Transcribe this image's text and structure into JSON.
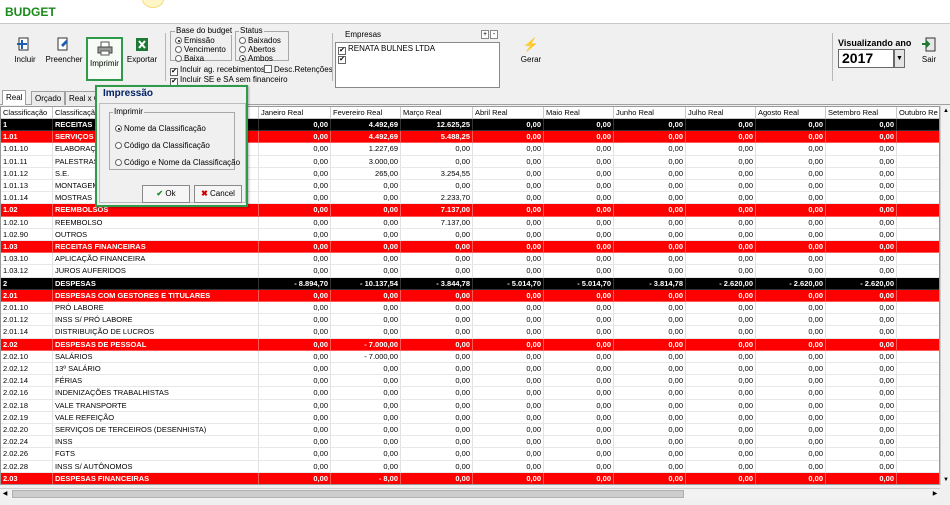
{
  "window": {
    "title": "BUDGET"
  },
  "toolbar": {
    "buttons": [
      {
        "label": "Incluir",
        "icon": "add-doc-icon"
      },
      {
        "label": "Preencher",
        "icon": "fill-icon"
      },
      {
        "label": "Imprimir",
        "icon": "printer-icon"
      },
      {
        "label": "Exportar",
        "icon": "excel-icon"
      },
      {
        "label": "Gerar",
        "icon": "lightning-icon"
      },
      {
        "label": "Sair",
        "icon": "exit-icon"
      }
    ],
    "base": {
      "title": "Base do budget",
      "options": [
        "Emissão",
        "Vencimento",
        "Baixa"
      ],
      "selected": "Emissão"
    },
    "status": {
      "title": "Status",
      "options": [
        "Baixados",
        "Abertos",
        "Ambos"
      ],
      "selected": "Ambos"
    },
    "checks": {
      "incluir_ag": "Incluir ag. recebimentos",
      "desc_ret": "Desc.Retenções",
      "incluir_se": "Incluir SE e SA sem financeiro"
    },
    "empresas": {
      "title": "Empresas",
      "plus": "+",
      "minus": "-",
      "items": [
        "RENATA BULNES LTDA",
        ""
      ]
    },
    "visualizando": {
      "label": "Visualizando ano",
      "year": "2017"
    }
  },
  "tabs": [
    "Real",
    "Orçado",
    "Real x O"
  ],
  "grid": {
    "headers": [
      "Classificação",
      "Classificação",
      "Janeiro Real",
      "Fevereiro Real",
      "Março Real",
      "Abril Real",
      "Maio Real",
      "Junho Real",
      "Julho Real",
      "Agosto Real",
      "Setembro Real",
      "Outubro Re"
    ],
    "rows": [
      {
        "code": "1",
        "name": "RECEITAS",
        "style": "black",
        "v": [
          "0,00",
          "4.492,69",
          "12.625,25",
          "0,00",
          "0,00",
          "0,00",
          "0,00",
          "0,00",
          "0,00"
        ]
      },
      {
        "code": "1.01",
        "name": "SERVIÇOS",
        "style": "red",
        "v": [
          "0,00",
          "4.492,69",
          "5.488,25",
          "0,00",
          "0,00",
          "0,00",
          "0,00",
          "0,00",
          "0,00"
        ]
      },
      {
        "code": "1.01.10",
        "name": "ELABORAÇÃO",
        "style": "",
        "v": [
          "0,00",
          "1.227,69",
          "0,00",
          "0,00",
          "0,00",
          "0,00",
          "0,00",
          "0,00",
          "0,00"
        ]
      },
      {
        "code": "1.01.11",
        "name": "PALESTRAS",
        "style": "",
        "v": [
          "0,00",
          "3.000,00",
          "0,00",
          "0,00",
          "0,00",
          "0,00",
          "0,00",
          "0,00",
          "0,00"
        ]
      },
      {
        "code": "1.01.12",
        "name": "S.E.",
        "style": "",
        "v": [
          "0,00",
          "265,00",
          "3.254,55",
          "0,00",
          "0,00",
          "0,00",
          "0,00",
          "0,00",
          "0,00"
        ]
      },
      {
        "code": "1.01.13",
        "name": "MONTAGEM",
        "style": "",
        "v": [
          "0,00",
          "0,00",
          "0,00",
          "0,00",
          "0,00",
          "0,00",
          "0,00",
          "0,00",
          "0,00"
        ]
      },
      {
        "code": "1.01.14",
        "name": "MOSTRAS",
        "style": "",
        "v": [
          "0,00",
          "0,00",
          "2.233,70",
          "0,00",
          "0,00",
          "0,00",
          "0,00",
          "0,00",
          "0,00"
        ]
      },
      {
        "code": "1.02",
        "name": "REEMBOLSOS",
        "style": "red",
        "v": [
          "0,00",
          "0,00",
          "7.137,00",
          "0,00",
          "0,00",
          "0,00",
          "0,00",
          "0,00",
          "0,00"
        ]
      },
      {
        "code": "1.02.10",
        "name": "REEMBOLSO",
        "style": "",
        "v": [
          "0,00",
          "0,00",
          "7.137,00",
          "0,00",
          "0,00",
          "0,00",
          "0,00",
          "0,00",
          "0,00"
        ]
      },
      {
        "code": "1.02.90",
        "name": "OUTROS",
        "style": "",
        "v": [
          "0,00",
          "0,00",
          "0,00",
          "0,00",
          "0,00",
          "0,00",
          "0,00",
          "0,00",
          "0,00"
        ]
      },
      {
        "code": "1.03",
        "name": "RECEITAS FINANCEIRAS",
        "style": "red",
        "v": [
          "0,00",
          "0,00",
          "0,00",
          "0,00",
          "0,00",
          "0,00",
          "0,00",
          "0,00",
          "0,00"
        ]
      },
      {
        "code": "1.03.10",
        "name": "APLICAÇÃO FINANCEIRA",
        "style": "",
        "v": [
          "0,00",
          "0,00",
          "0,00",
          "0,00",
          "0,00",
          "0,00",
          "0,00",
          "0,00",
          "0,00"
        ]
      },
      {
        "code": "1.03.12",
        "name": "JUROS AUFERIDOS",
        "style": "",
        "v": [
          "0,00",
          "0,00",
          "0,00",
          "0,00",
          "0,00",
          "0,00",
          "0,00",
          "0,00",
          "0,00"
        ]
      },
      {
        "code": "2",
        "name": "DESPESAS",
        "style": "black",
        "v": [
          "- 8.894,70",
          "- 10.137,54",
          "- 3.844,78",
          "- 5.014,70",
          "- 5.014,70",
          "- 3.814,78",
          "- 2.620,00",
          "- 2.620,00",
          "- 2.620,00"
        ]
      },
      {
        "code": "2.01",
        "name": "DESPESAS COM GESTORES E TITULARES",
        "style": "red",
        "v": [
          "0,00",
          "0,00",
          "0,00",
          "0,00",
          "0,00",
          "0,00",
          "0,00",
          "0,00",
          "0,00"
        ]
      },
      {
        "code": "2.01.10",
        "name": "PRÓ LABORE",
        "style": "",
        "v": [
          "0,00",
          "0,00",
          "0,00",
          "0,00",
          "0,00",
          "0,00",
          "0,00",
          "0,00",
          "0,00"
        ]
      },
      {
        "code": "2.01.12",
        "name": "INSS S/ PRÓ LABORE",
        "style": "",
        "v": [
          "0,00",
          "0,00",
          "0,00",
          "0,00",
          "0,00",
          "0,00",
          "0,00",
          "0,00",
          "0,00"
        ]
      },
      {
        "code": "2.01.14",
        "name": "DISTRIBUIÇÃO DE LUCROS",
        "style": "",
        "v": [
          "0,00",
          "0,00",
          "0,00",
          "0,00",
          "0,00",
          "0,00",
          "0,00",
          "0,00",
          "0,00"
        ]
      },
      {
        "code": "2.02",
        "name": "DESPESAS DE PESSOAL",
        "style": "red",
        "v": [
          "0,00",
          "- 7.000,00",
          "0,00",
          "0,00",
          "0,00",
          "0,00",
          "0,00",
          "0,00",
          "0,00"
        ]
      },
      {
        "code": "2.02.10",
        "name": "SALÁRIOS",
        "style": "",
        "v": [
          "0,00",
          "- 7.000,00",
          "0,00",
          "0,00",
          "0,00",
          "0,00",
          "0,00",
          "0,00",
          "0,00"
        ]
      },
      {
        "code": "2.02.12",
        "name": "13º SALÁRIO",
        "style": "",
        "v": [
          "0,00",
          "0,00",
          "0,00",
          "0,00",
          "0,00",
          "0,00",
          "0,00",
          "0,00",
          "0,00"
        ]
      },
      {
        "code": "2.02.14",
        "name": "FÉRIAS",
        "style": "",
        "v": [
          "0,00",
          "0,00",
          "0,00",
          "0,00",
          "0,00",
          "0,00",
          "0,00",
          "0,00",
          "0,00"
        ]
      },
      {
        "code": "2.02.16",
        "name": "INDENIZAÇÕES TRABALHISTAS",
        "style": "",
        "v": [
          "0,00",
          "0,00",
          "0,00",
          "0,00",
          "0,00",
          "0,00",
          "0,00",
          "0,00",
          "0,00"
        ]
      },
      {
        "code": "2.02.18",
        "name": "VALE TRANSPORTE",
        "style": "",
        "v": [
          "0,00",
          "0,00",
          "0,00",
          "0,00",
          "0,00",
          "0,00",
          "0,00",
          "0,00",
          "0,00"
        ]
      },
      {
        "code": "2.02.19",
        "name": "VALE REFEIÇÃO",
        "style": "",
        "v": [
          "0,00",
          "0,00",
          "0,00",
          "0,00",
          "0,00",
          "0,00",
          "0,00",
          "0,00",
          "0,00"
        ]
      },
      {
        "code": "2.02.20",
        "name": "SERVIÇOS DE TERCEIROS (DESENHISTA)",
        "style": "",
        "v": [
          "0,00",
          "0,00",
          "0,00",
          "0,00",
          "0,00",
          "0,00",
          "0,00",
          "0,00",
          "0,00"
        ]
      },
      {
        "code": "2.02.24",
        "name": "INSS",
        "style": "",
        "v": [
          "0,00",
          "0,00",
          "0,00",
          "0,00",
          "0,00",
          "0,00",
          "0,00",
          "0,00",
          "0,00"
        ]
      },
      {
        "code": "2.02.26",
        "name": "FGTS",
        "style": "",
        "v": [
          "0,00",
          "0,00",
          "0,00",
          "0,00",
          "0,00",
          "0,00",
          "0,00",
          "0,00",
          "0,00"
        ]
      },
      {
        "code": "2.02.28",
        "name": "INSS S/ AUTÔNOMOS",
        "style": "",
        "v": [
          "0,00",
          "0,00",
          "0,00",
          "0,00",
          "0,00",
          "0,00",
          "0,00",
          "0,00",
          "0,00"
        ]
      },
      {
        "code": "2.03",
        "name": "DESPESAS FINANCEIRAS",
        "style": "red",
        "v": [
          "0,00",
          "- 8,00",
          "0,00",
          "0,00",
          "0,00",
          "0,00",
          "0,00",
          "0,00",
          "0,00"
        ]
      }
    ]
  },
  "dialog": {
    "title": "Impressão",
    "group_label": "Imprimir",
    "options": [
      "Nome da Classificação",
      "Código da Classificação",
      "Código e Nome da Classificação"
    ],
    "selected": "Nome da Classificação",
    "ok": "Ok",
    "cancel": "Cancel"
  },
  "colors": {
    "section_red": "#ff0000",
    "group_black": "#000000",
    "accent_green": "#2e9a4a",
    "title_green": "#1a8a1a"
  }
}
